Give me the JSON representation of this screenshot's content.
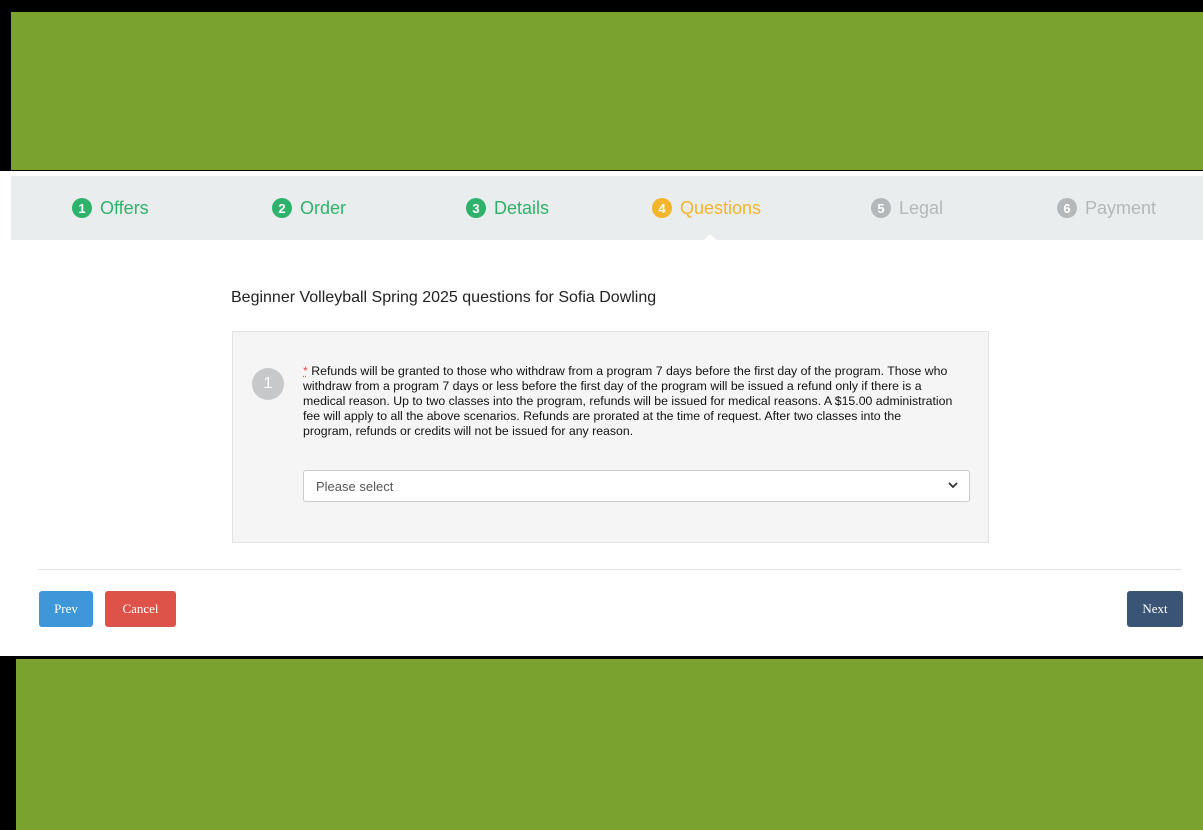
{
  "steps": [
    {
      "number": "1",
      "label": "Offers",
      "state": "done"
    },
    {
      "number": "2",
      "label": "Order",
      "state": "done"
    },
    {
      "number": "3",
      "label": "Details",
      "state": "done"
    },
    {
      "number": "4",
      "label": "Questions",
      "state": "current"
    },
    {
      "number": "5",
      "label": "Legal",
      "state": "todo"
    },
    {
      "number": "6",
      "label": "Payment",
      "state": "todo"
    }
  ],
  "question_section": {
    "title": "Beginner Volleyball Spring 2025 questions for Sofia Dowling",
    "questions": [
      {
        "number": "1",
        "required_marker": "*",
        "text": "Refunds will be granted to those who withdraw from a program 7 days before the first day of the program. Those who withdraw from a program 7 days or less before the first day of the program will be issued a refund only if there is a medical reason. Up to two classes into the program, refunds will be issued for medical reasons. A $15.00 administration fee will apply to all the above scenarios. Refunds are prorated at the time of request. After two classes into the program, refunds or credits will not be issued for any reason.",
        "select_value": "Please select"
      }
    ]
  },
  "buttons": {
    "prev": "Prev",
    "cancel": "Cancel",
    "next": "Next"
  },
  "colors": {
    "banner": "#7aa22e",
    "step_done": "#2fb36c",
    "step_current": "#f2b52b",
    "step_todo": "#b5b8ba",
    "prev_button": "#3d97d9",
    "cancel_button": "#dd5349",
    "next_button": "#3a5476"
  }
}
